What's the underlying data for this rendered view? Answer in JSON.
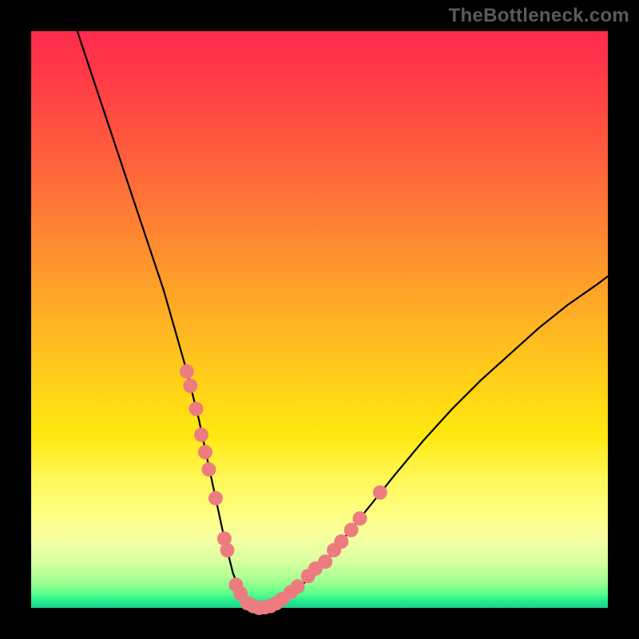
{
  "watermark": "TheBottleneck.com",
  "colors": {
    "dot": "#ec7c80",
    "curve": "#000000",
    "frame": "#000000"
  },
  "chart_data": {
    "type": "line",
    "title": "",
    "xlabel": "",
    "ylabel": "",
    "xlim": [
      0,
      100
    ],
    "ylim": [
      0,
      100
    ],
    "series": [
      {
        "name": "bottleneck-curve",
        "x": [
          8,
          11,
          14,
          17,
          20,
          23,
          25,
          27,
          29,
          30.5,
          32,
          33.5,
          35,
          37,
          39,
          41,
          43.5,
          47,
          51,
          55,
          59,
          63,
          68,
          73,
          78,
          83,
          88,
          93,
          98,
          100
        ],
        "y": [
          100,
          91,
          82,
          73,
          64,
          55,
          48,
          41,
          33,
          26,
          19,
          12,
          6,
          1,
          0,
          0,
          1.5,
          4,
          8,
          13,
          18,
          23,
          29,
          34.5,
          39.5,
          44,
          48.5,
          52.5,
          56,
          57.5
        ]
      }
    ],
    "markers": [
      {
        "name": "left-cluster-1",
        "x": 27.0,
        "y": 41.0
      },
      {
        "name": "left-cluster-2",
        "x": 27.6,
        "y": 38.5
      },
      {
        "name": "left-cluster-3",
        "x": 28.6,
        "y": 34.5
      },
      {
        "name": "left-cluster-4",
        "x": 29.5,
        "y": 30.0
      },
      {
        "name": "left-cluster-5",
        "x": 30.2,
        "y": 27.0
      },
      {
        "name": "left-cluster-6",
        "x": 30.8,
        "y": 24.0
      },
      {
        "name": "left-cluster-7",
        "x": 32.0,
        "y": 19.0
      },
      {
        "name": "left-cluster-8",
        "x": 33.5,
        "y": 12.0
      },
      {
        "name": "left-cluster-9",
        "x": 34.0,
        "y": 10.0
      },
      {
        "name": "bottom-1",
        "x": 35.5,
        "y": 4.0
      },
      {
        "name": "bottom-2",
        "x": 36.3,
        "y": 2.5
      },
      {
        "name": "bottom-3",
        "x": 37.5,
        "y": 0.8
      },
      {
        "name": "bottom-4",
        "x": 38.5,
        "y": 0.3
      },
      {
        "name": "bottom-5",
        "x": 39.5,
        "y": 0.0
      },
      {
        "name": "bottom-6",
        "x": 40.5,
        "y": 0.1
      },
      {
        "name": "bottom-7",
        "x": 41.5,
        "y": 0.3
      },
      {
        "name": "bottom-8",
        "x": 42.5,
        "y": 0.8
      },
      {
        "name": "bottom-9",
        "x": 43.5,
        "y": 1.5
      },
      {
        "name": "right-cluster-1",
        "x": 45.0,
        "y": 2.7
      },
      {
        "name": "right-cluster-2",
        "x": 46.2,
        "y": 3.7
      },
      {
        "name": "right-cluster-3",
        "x": 48.0,
        "y": 5.5
      },
      {
        "name": "right-cluster-4",
        "x": 49.3,
        "y": 6.8
      },
      {
        "name": "right-cluster-5",
        "x": 51.0,
        "y": 8.0
      },
      {
        "name": "right-cluster-6",
        "x": 52.5,
        "y": 10.0
      },
      {
        "name": "right-cluster-7",
        "x": 53.8,
        "y": 11.5
      },
      {
        "name": "right-cluster-8",
        "x": 55.5,
        "y": 13.5
      },
      {
        "name": "right-cluster-9",
        "x": 57.0,
        "y": 15.5
      },
      {
        "name": "right-outlier",
        "x": 60.5,
        "y": 20.0
      }
    ]
  }
}
